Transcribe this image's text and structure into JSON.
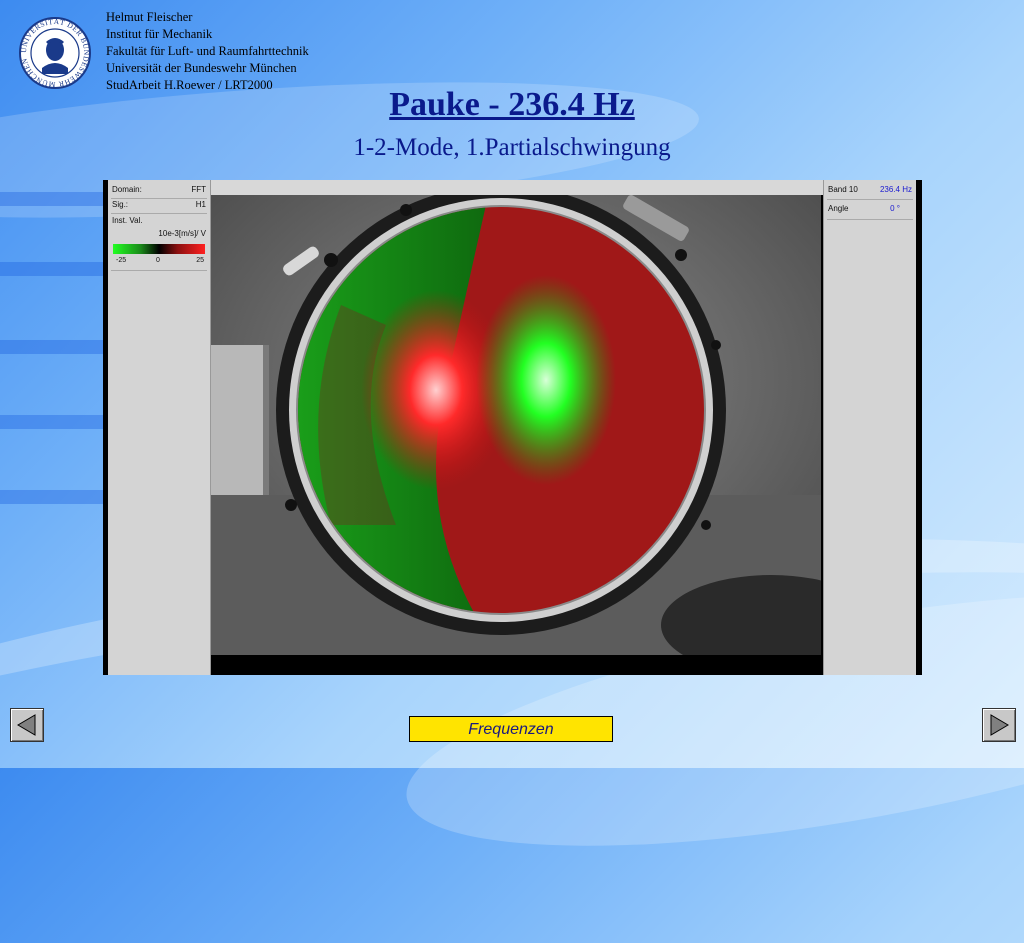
{
  "header": {
    "lines": [
      "Helmut Fleischer",
      "Institut für Mechanik",
      "Fakultät für Luft- und Raumfahrttechnik",
      "Universität der Bundeswehr München",
      "StudArbeit H.Roewer / LRT2000"
    ],
    "logo_text": "UNIVERSITÄT DER BUNDESWEHR MÜNCHEN"
  },
  "slide": {
    "title": "Pauke - 236.4 Hz",
    "subtitle": "1-2-Mode, 1.Partialschwingung"
  },
  "left_panel": {
    "domain_label": "Domain:",
    "domain_value": "FFT",
    "sig_label": "Sig.:",
    "sig_value": "H1",
    "instval_label": "Inst. Val.",
    "unit": "10e-3[m/s]/ V",
    "scale_min": "-25",
    "scale_mid": "0",
    "scale_max": "25",
    "colors": {
      "neg": "#22ff22",
      "pos": "#ff2020"
    }
  },
  "right_panel": {
    "band_label": "Band 10",
    "band_value": "236.4 Hz",
    "angle_label": "Angle",
    "angle_value": "0 °",
    "value_color": "#1a1ad0"
  },
  "navigation": {
    "prev_icon": "triangle-left-icon",
    "next_icon": "triangle-right-icon",
    "frequencies_label": "Frequenzen",
    "button_color": "#ffe400"
  }
}
